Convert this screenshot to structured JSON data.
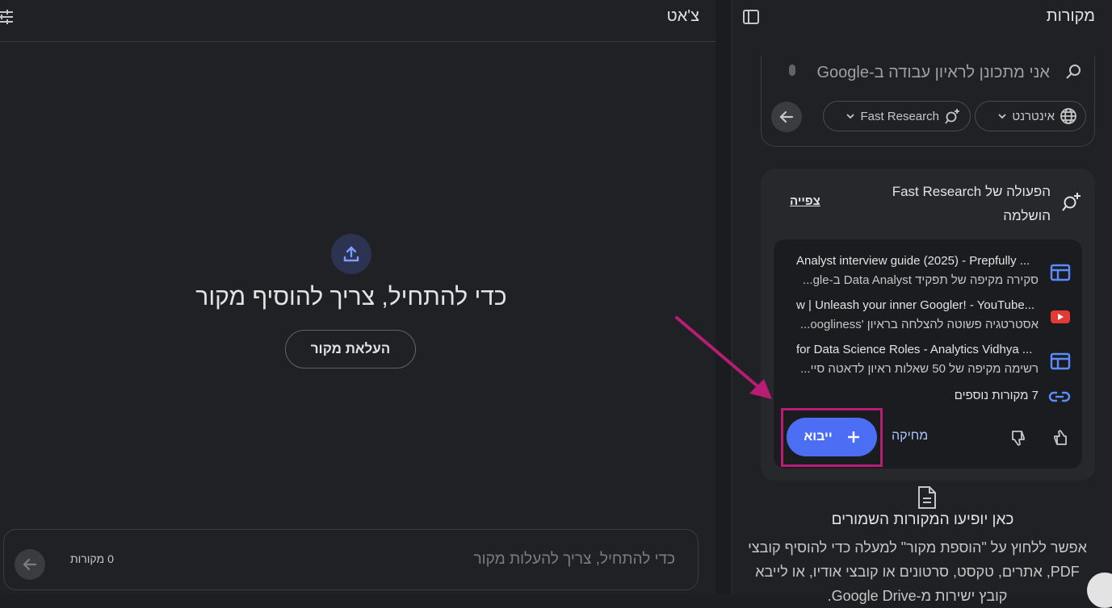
{
  "chat": {
    "title": "צ'אט",
    "empty_title": "כדי להתחיל, צריך להוסיף מקור",
    "upload_button": "העלאת מקור",
    "input_placeholder": "כדי להתחיל, צריך להעלות מקור",
    "source_count": "0 מקורות"
  },
  "sources": {
    "title": "מקורות",
    "search_text": "אני מתכונן לראיון עבודה ב-Google",
    "chip_web": "אינטרנט",
    "chip_research": "Fast Research",
    "research_card": {
      "title": "הפעולה של Fast Research הושלמה",
      "view_link": "צפייה",
      "results": [
        {
          "title": "Analyst interview guide (2025) - Prepfully ...",
          "subtitle": "סקירה מקיפה של תפקיד Data Analyst ב-gle...",
          "icon": "web-article-icon"
        },
        {
          "title": "w | Unleash your inner Googler! - YouTube...",
          "subtitle": "אסטרטגיה פשוטה להצלחה בראיון 'oogliness...",
          "icon": "youtube-icon"
        },
        {
          "title": "for Data Science Roles - Analytics Vidhya ...",
          "subtitle": "רשימה מקיפה של 50 שאלות ראיון לדאטה סיי...",
          "icon": "web-article-icon"
        }
      ],
      "more_sources": "7 מקורות נוספים",
      "import_button": "ייבוא",
      "delete_button": "מחיקה"
    },
    "saved": {
      "title": "כאן יופיעו המקורות השמורים",
      "text": "אפשר ללחוץ על \"הוספת מקור\" למעלה כדי להוסיף קובצי PDF, אתרים, טקסט, סרטונים או קובצי אודיו, או לייבא קובץ ישירות מ-Google Drive."
    }
  },
  "colors": {
    "accent": "#4c6ef5",
    "highlight": "#b81c73",
    "youtube": "#e53935",
    "link": "#a8c7fa"
  }
}
